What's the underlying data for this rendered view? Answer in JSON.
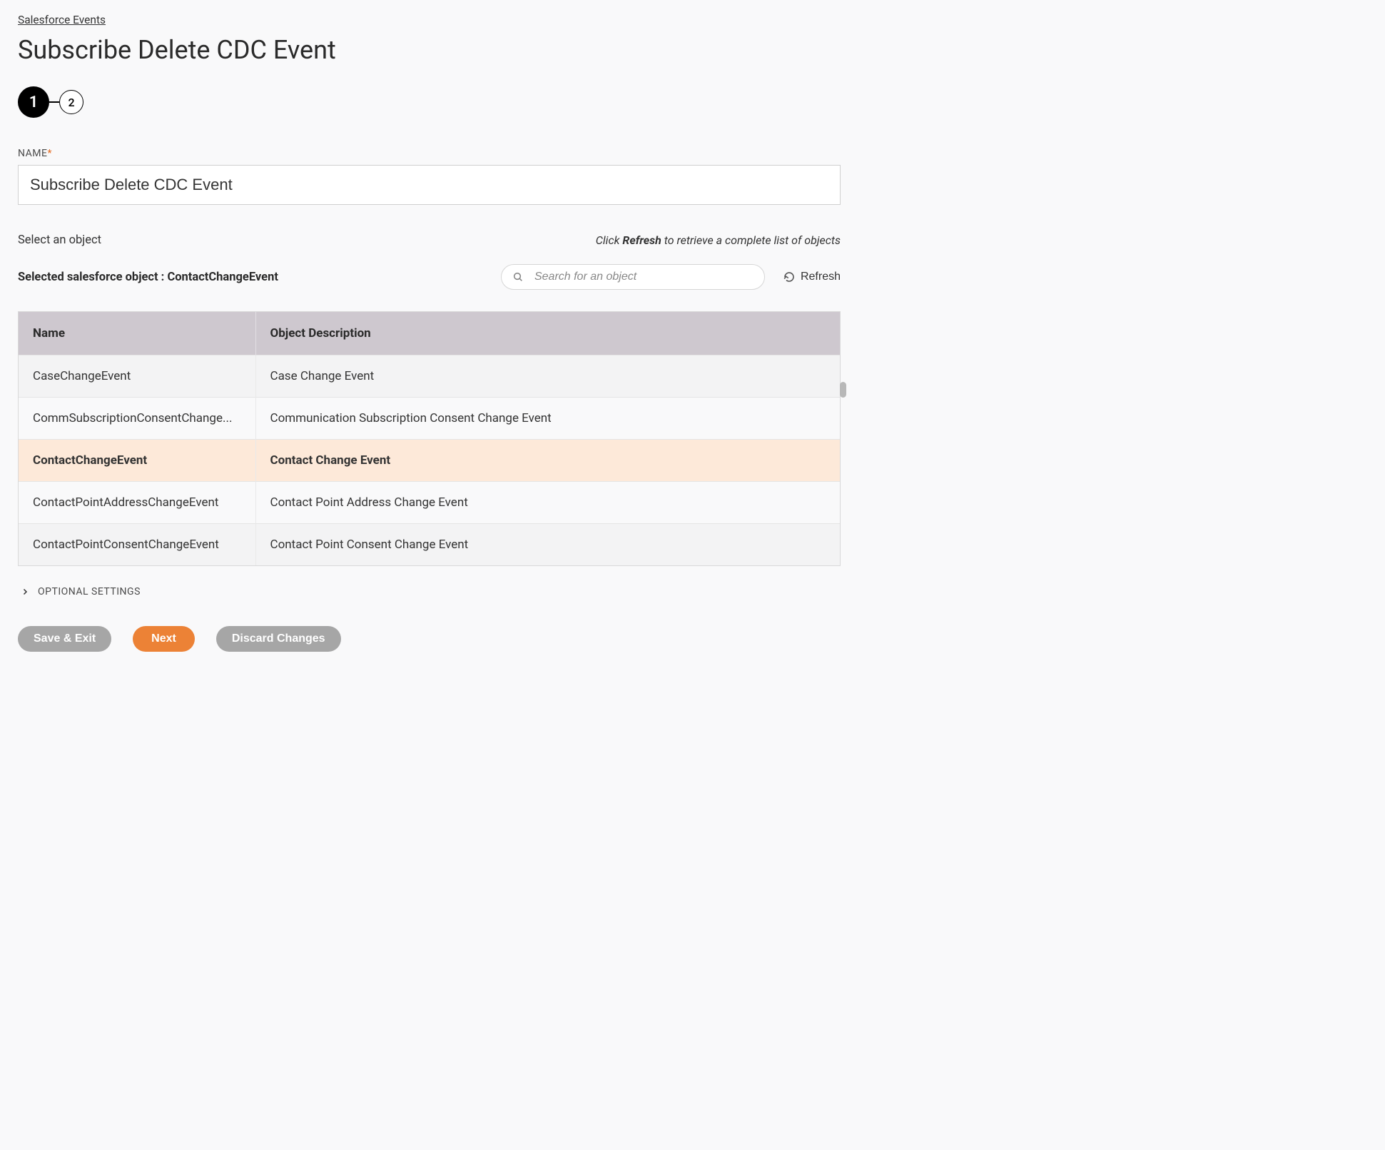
{
  "breadcrumb": "Salesforce Events",
  "page_title": "Subscribe Delete CDC Event",
  "stepper": {
    "step1": "1",
    "step2": "2"
  },
  "name_field": {
    "label": "NAME",
    "required_mark": "*",
    "value": "Subscribe Delete CDC Event"
  },
  "select_object_label": "Select an object",
  "hint": {
    "prefix": "Click ",
    "bold": "Refresh",
    "suffix": " to retrieve a complete list of objects"
  },
  "selected_object": {
    "prefix": "Selected salesforce object : ",
    "value": "ContactChangeEvent"
  },
  "search": {
    "placeholder": "Search for an object"
  },
  "refresh_label": "Refresh",
  "table": {
    "headers": {
      "name": "Name",
      "desc": "Object Description"
    },
    "rows": [
      {
        "name": "CaseChangeEvent",
        "desc": "Case Change Event",
        "alt": true
      },
      {
        "name": "CommSubscriptionConsentChange...",
        "desc": "Communication Subscription Consent Change Event"
      },
      {
        "name": "ContactChangeEvent",
        "desc": "Contact Change Event",
        "selected": true
      },
      {
        "name": "ContactPointAddressChangeEvent",
        "desc": "Contact Point Address Change Event"
      },
      {
        "name": "ContactPointConsentChangeEvent",
        "desc": "Contact Point Consent Change Event",
        "alt": true
      }
    ]
  },
  "optional_settings_label": "OPTIONAL SETTINGS",
  "buttons": {
    "save_exit": "Save & Exit",
    "next": "Next",
    "discard": "Discard Changes"
  }
}
